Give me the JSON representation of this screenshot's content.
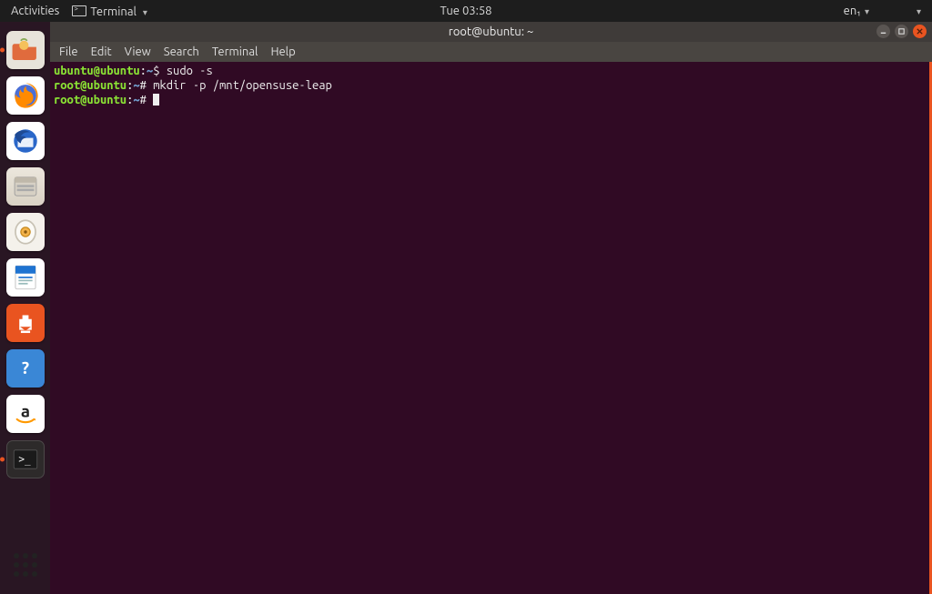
{
  "top_panel": {
    "activities": "Activities",
    "app_menu": "Terminal",
    "clock": "Tue 03:58",
    "input_source": "en₁"
  },
  "dock": {
    "items": [
      {
        "name": "files",
        "running": true
      },
      {
        "name": "firefox"
      },
      {
        "name": "thunderbird"
      },
      {
        "name": "nautilus"
      },
      {
        "name": "rhythmbox"
      },
      {
        "name": "writer"
      },
      {
        "name": "software"
      },
      {
        "name": "help"
      },
      {
        "name": "amazon"
      },
      {
        "name": "terminal",
        "running": true,
        "active": true
      }
    ]
  },
  "window": {
    "title": "root@ubuntu: ~",
    "menu": [
      "File",
      "Edit",
      "View",
      "Search",
      "Terminal",
      "Help"
    ]
  },
  "terminal": {
    "lines": [
      {
        "user": "ubuntu@ubuntu",
        "sep": ":",
        "path": "~",
        "sym": "$",
        "cmd": " sudo -s"
      },
      {
        "user": "root@ubuntu",
        "sep": ":",
        "path": "~",
        "sym": "#",
        "cmd": " mkdir -p /mnt/opensuse-leap"
      },
      {
        "user": "root@ubuntu",
        "sep": ":",
        "path": "~",
        "sym": "#",
        "cmd": " ",
        "cursor": true
      }
    ]
  }
}
